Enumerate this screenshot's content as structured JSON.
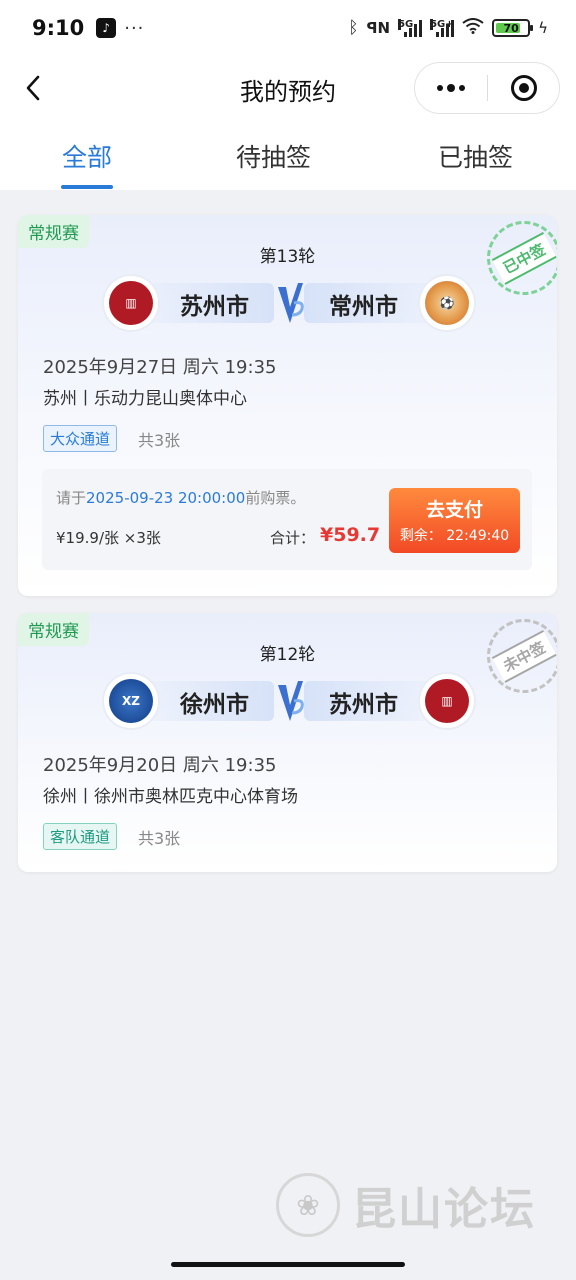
{
  "status_bar": {
    "time": "9:10",
    "more": "···",
    "net1": "5G",
    "net2": "5G+",
    "battery": "70"
  },
  "nav": {
    "title": "我的预约"
  },
  "tabs": [
    {
      "label": "全部",
      "active": true
    },
    {
      "label": "待抽签",
      "active": false
    },
    {
      "label": "已抽签",
      "active": false
    }
  ],
  "cards": [
    {
      "tag": "常规赛",
      "round": "第13轮",
      "stamp": "已中签",
      "home_team": "苏州市",
      "away_team": "常州市",
      "datetime": "2025年9月27日 周六 19:35",
      "venue": "苏州丨乐动力昆山奥体中心",
      "channel": "大众通道",
      "count": "共3张",
      "pay": {
        "note_prefix": "请于",
        "deadline": "2025-09-23 20:00:00",
        "note_suffix": "前购票。",
        "price": "¥19.9/张 ×3张",
        "total_label": "合计：",
        "total": "¥59.7",
        "button": "去支付",
        "remaining": "剩余： 22:49:40"
      }
    },
    {
      "tag": "常规赛",
      "round": "第12轮",
      "stamp": "未中签",
      "home_team": "徐州市",
      "away_team": "苏州市",
      "datetime": "2025年9月20日 周六 19:35",
      "venue": "徐州丨徐州市奥林匹克中心体育场",
      "channel": "客队通道",
      "count": "共3张"
    }
  ],
  "watermark": "昆山论坛",
  "colors": {
    "accent": "#2a7bd8",
    "price": "#e53935",
    "pay_button": "#f24a26",
    "tag_green": "#1f9a52"
  }
}
